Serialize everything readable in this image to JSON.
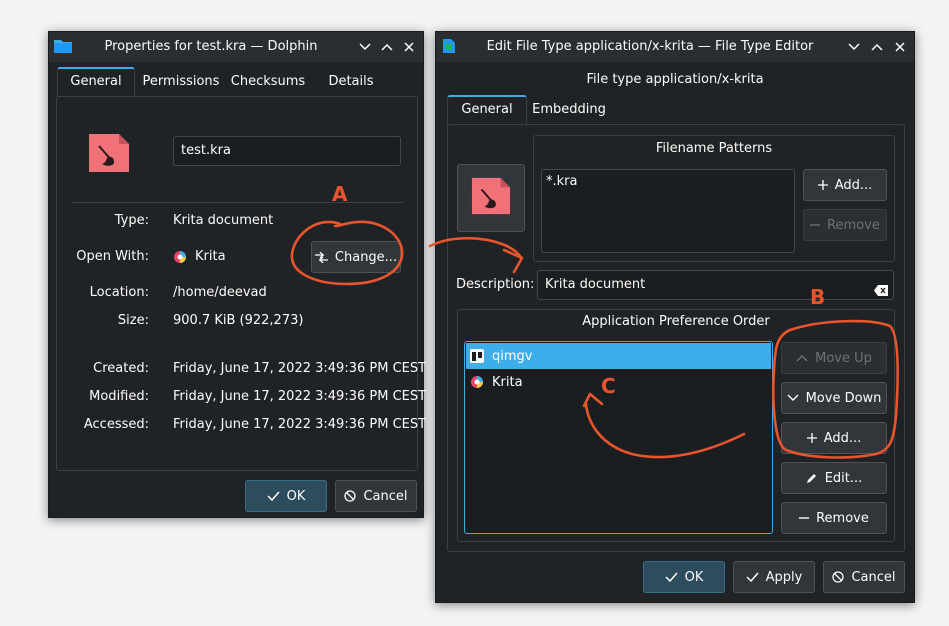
{
  "colors": {
    "accent": "#3daee9",
    "annotation": "#e8552d",
    "icon_bg": "#f07178"
  },
  "props_window": {
    "title": "Properties for test.kra — Dolphin",
    "tabs": [
      "General",
      "Permissions",
      "Checksums",
      "Details"
    ],
    "filename": "test.kra",
    "type_label": "Type:",
    "type_value": "Krita document",
    "open_with_label": "Open With:",
    "open_with_value": "Krita",
    "change_button": "Change...",
    "location_label": "Location:",
    "location_value": "/home/deevad",
    "size_label": "Size:",
    "size_value": "900.7 KiB (922,273)",
    "created_label": "Created:",
    "created_value": "Friday, June 17, 2022 3:49:36 PM CEST",
    "modified_label": "Modified:",
    "modified_value": "Friday, June 17, 2022 3:49:36 PM CEST",
    "accessed_label": "Accessed:",
    "accessed_value": "Friday, June 17, 2022 3:49:36 PM CEST",
    "ok_button": "OK",
    "cancel_button": "Cancel"
  },
  "editor_window": {
    "title": "Edit File Type application/x-krita — File Type Editor",
    "heading": "File type application/x-krita",
    "tabs": [
      "General",
      "Embedding"
    ],
    "filename_patterns_title": "Filename Patterns",
    "patterns": [
      "*.kra"
    ],
    "add_button": "Add...",
    "remove_button": "Remove",
    "description_label": "Description:",
    "description_value": "Krita document",
    "app_pref_title": "Application Preference Order",
    "apps": [
      {
        "name": "qimgv",
        "selected": true
      },
      {
        "name": "Krita",
        "selected": false
      }
    ],
    "move_up_button": "Move Up",
    "move_down_button": "Move Down",
    "add2_button": "Add...",
    "edit_button": "Edit...",
    "remove2_button": "Remove",
    "ok_button": "OK",
    "apply_button": "Apply",
    "cancel_button": "Cancel"
  },
  "annotations": {
    "a": "A",
    "b": "B",
    "c": "C"
  }
}
